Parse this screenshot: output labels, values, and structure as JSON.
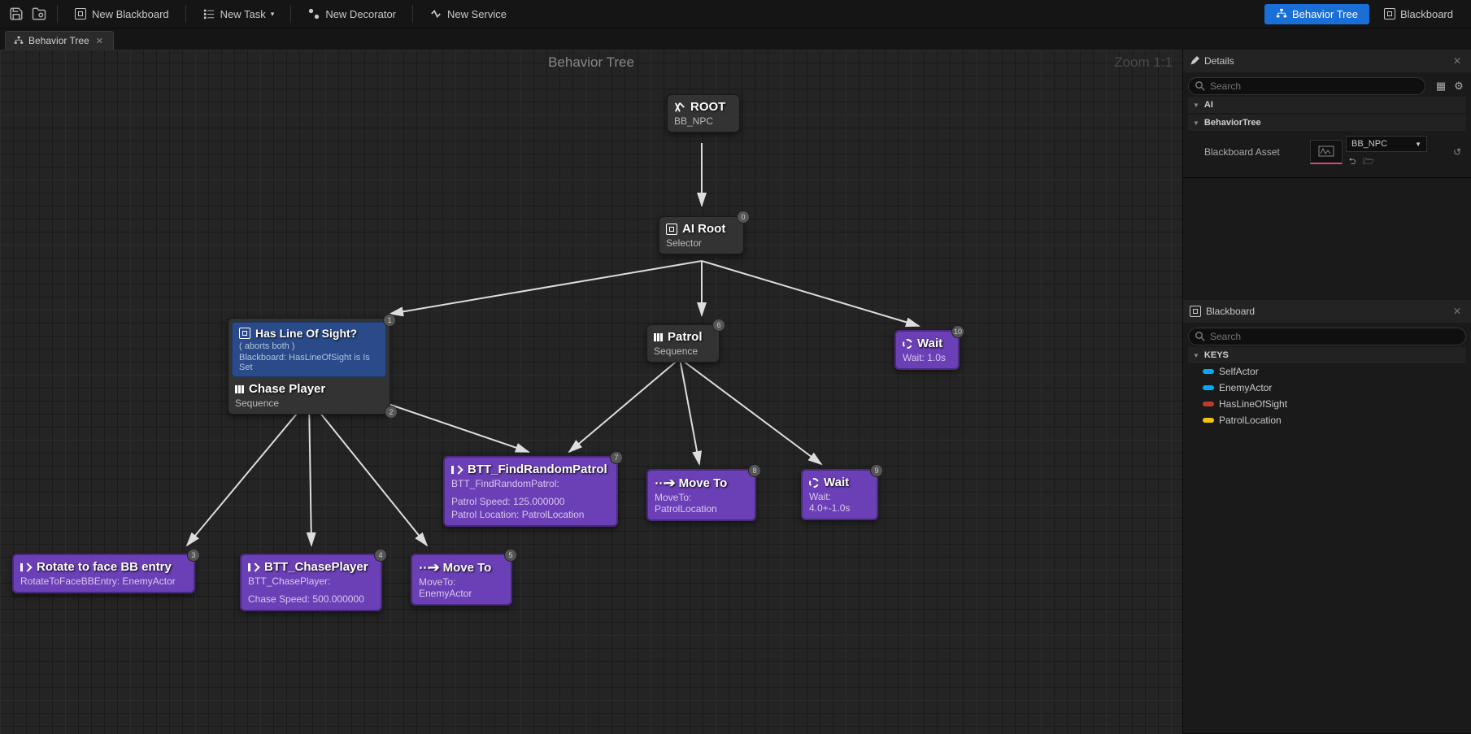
{
  "toolbar": {
    "new_blackboard": "New Blackboard",
    "new_task": "New Task",
    "new_decorator": "New Decorator",
    "new_service": "New Service",
    "mode_bt": "Behavior Tree",
    "mode_bb": "Blackboard"
  },
  "tab": {
    "title": "Behavior Tree"
  },
  "graph": {
    "title": "Behavior Tree",
    "zoom": "Zoom 1:1"
  },
  "nodes": {
    "root": {
      "title": "ROOT",
      "sub": "BB_NPC"
    },
    "ai_root": {
      "title": "AI Root",
      "sub": "Selector",
      "idx": "0"
    },
    "chase": {
      "dec_title": "Has Line Of Sight?",
      "dec_sub1": "( aborts both )",
      "dec_sub2": "Blackboard: HasLineOfSight is Is Set",
      "title": "Chase Player",
      "sub": "Sequence",
      "idx1": "1",
      "idx2": "2"
    },
    "patrol": {
      "title": "Patrol",
      "sub": "Sequence",
      "idx": "6"
    },
    "wait_r": {
      "title": "Wait",
      "sub": "Wait: 1.0s",
      "idx": "10"
    },
    "rotate": {
      "title": "Rotate to face BB entry",
      "sub": "RotateToFaceBBEntry: EnemyActor",
      "idx": "3"
    },
    "btt_chase": {
      "title": "BTT_ChasePlayer",
      "sub": "BTT_ChasePlayer:",
      "sub2": "Chase Speed: 500.000000",
      "idx": "4"
    },
    "moveto1": {
      "title": "Move To",
      "sub": "MoveTo: EnemyActor",
      "idx": "5"
    },
    "findpatrol": {
      "title": "BTT_FindRandomPatrol",
      "sub": "BTT_FindRandomPatrol:",
      "sub2": "Patrol Speed: 125.000000",
      "sub3": "Patrol Location: PatrolLocation",
      "idx": "7"
    },
    "moveto2": {
      "title": "Move To",
      "sub": "MoveTo: PatrolLocation",
      "idx": "8"
    },
    "wait2": {
      "title": "Wait",
      "sub": "Wait: 4.0+-1.0s",
      "idx": "9"
    }
  },
  "details": {
    "title": "Details",
    "search_ph": "Search",
    "cat_ai": "AI",
    "cat_bt": "BehaviorTree",
    "prop_bb": "Blackboard Asset",
    "bb_val": "BB_NPC"
  },
  "blackboard": {
    "title": "Blackboard",
    "search_ph": "Search",
    "cat_keys": "KEYS",
    "keys": [
      {
        "name": "SelfActor",
        "color": "#00aaff"
      },
      {
        "name": "EnemyActor",
        "color": "#00aaff"
      },
      {
        "name": "HasLineOfSight",
        "color": "#c0392b"
      },
      {
        "name": "PatrolLocation",
        "color": "#f1c40f"
      }
    ]
  }
}
